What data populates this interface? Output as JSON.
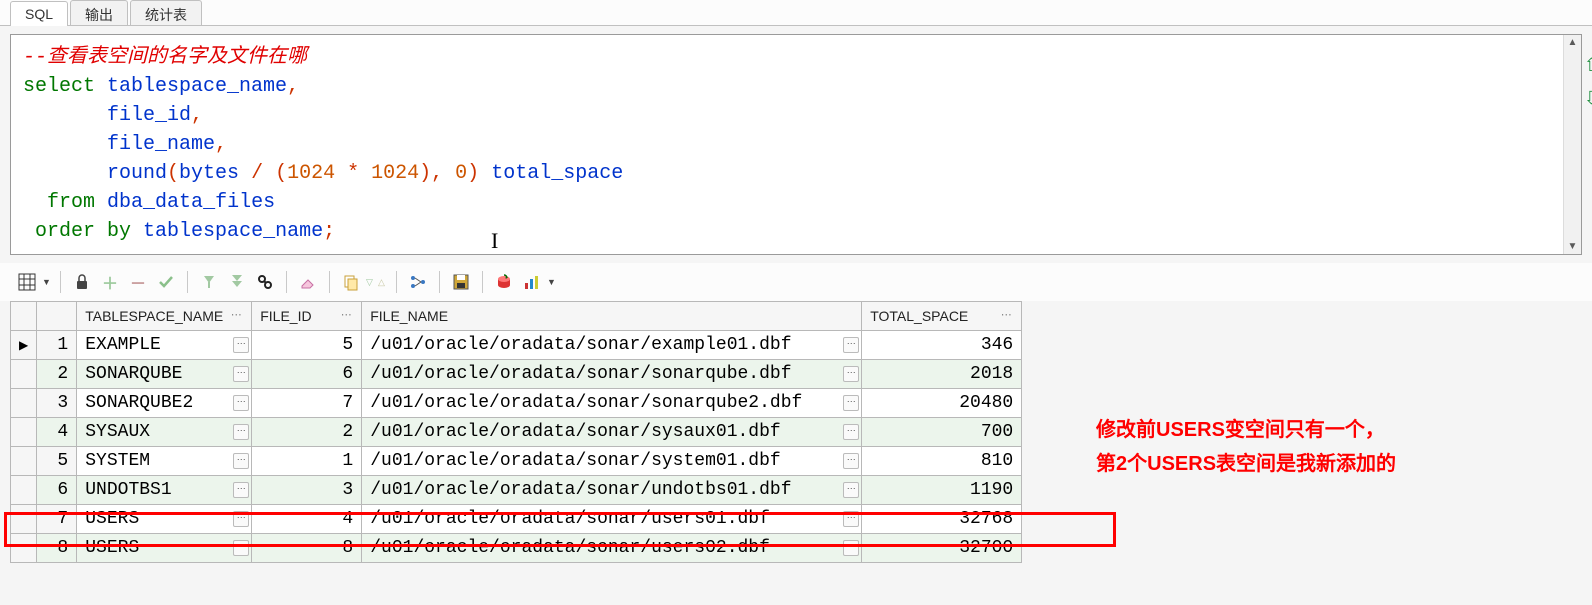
{
  "tabs": {
    "sql": "SQL",
    "output": "输出",
    "stats": "统计表"
  },
  "sql": {
    "comment": "--查看表空间的名字及文件在哪",
    "line2_kw": "select",
    "line2_a": "tablespace_name",
    "line2_p": ",",
    "line3_a": "file_id",
    "line3_p": ",",
    "line4_a": "file_name",
    "line4_p": ",",
    "line5_a1": "round",
    "line5_p1": "(",
    "line5_a2": "bytes",
    "line5_op": " / (",
    "line5_n1": "1024",
    "line5_op2": " * ",
    "line5_n2": "1024",
    "line5_p2": "),",
    "line5_sp": " ",
    "line5_n3": "0",
    "line5_p3": ")",
    "line5_sp2": " ",
    "line5_a3": "total_space",
    "line6_kw": "from",
    "line6_a": "dba_data_files",
    "line7_kw": "order by",
    "line7_a": "tablespace_name",
    "line7_p": ";"
  },
  "grid": {
    "headers": {
      "ts": "TABLESPACE_NAME",
      "fid": "FILE_ID",
      "fname": "FILE_NAME",
      "tspace": "TOTAL_SPACE"
    },
    "rows": [
      {
        "rn": "1",
        "ts": "EXAMPLE",
        "fid": "5",
        "fname": "/u01/oracle/oradata/sonar/example01.dbf",
        "tspace": "346",
        "indicator": "▶"
      },
      {
        "rn": "2",
        "ts": "SONARQUBE",
        "fid": "6",
        "fname": "/u01/oracle/oradata/sonar/sonarqube.dbf",
        "tspace": "2018",
        "indicator": ""
      },
      {
        "rn": "3",
        "ts": "SONARQUBE2",
        "fid": "7",
        "fname": "/u01/oracle/oradata/sonar/sonarqube2.dbf",
        "tspace": "20480",
        "indicator": ""
      },
      {
        "rn": "4",
        "ts": "SYSAUX",
        "fid": "2",
        "fname": "/u01/oracle/oradata/sonar/sysaux01.dbf",
        "tspace": "700",
        "indicator": ""
      },
      {
        "rn": "5",
        "ts": "SYSTEM",
        "fid": "1",
        "fname": "/u01/oracle/oradata/sonar/system01.dbf",
        "tspace": "810",
        "indicator": ""
      },
      {
        "rn": "6",
        "ts": "UNDOTBS1",
        "fid": "3",
        "fname": "/u01/oracle/oradata/sonar/undotbs01.dbf",
        "tspace": "1190",
        "indicator": ""
      },
      {
        "rn": "7",
        "ts": "USERS",
        "fid": "4",
        "fname": "/u01/oracle/oradata/sonar/users01.dbf",
        "tspace": "32768",
        "indicator": ""
      },
      {
        "rn": "8",
        "ts": "USERS",
        "fid": "8",
        "fname": "/u01/oracle/oradata/sonar/users02.dbf",
        "tspace": "32700",
        "indicator": ""
      }
    ]
  },
  "annotation": {
    "line1": "修改前USERS变空间只有一个，",
    "line2": "第2个USERS表空间是我新添加的"
  },
  "dots": "⋯"
}
